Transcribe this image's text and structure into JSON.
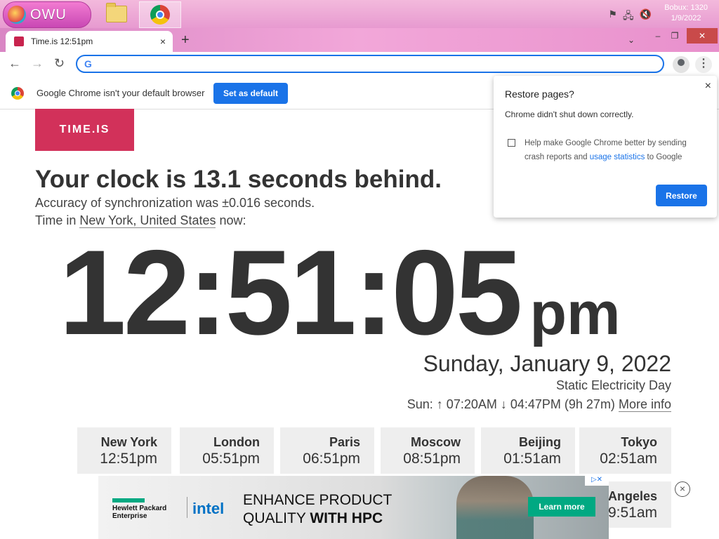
{
  "taskbar": {
    "start_label": "OWU",
    "clock_line1": "Bobux: 1320",
    "clock_line2": "1/9/2022"
  },
  "browser": {
    "tab_title": "Time.is 12:51pm",
    "new_tab": "+",
    "tab_close": "×",
    "omnibox_value": ""
  },
  "infobar": {
    "message": "Google Chrome isn't your default browser",
    "button": "Set as default"
  },
  "page": {
    "logo": "TIME.IS",
    "headline": "Your clock is 13.1 seconds behind.",
    "accuracy": "Accuracy of synchronization was ±0.016 seconds.",
    "time_in_prefix": "Time in",
    "location": "New York, United States",
    "time_in_suffix": "now:",
    "clock_time": "12:51:05",
    "clock_ampm": "pm",
    "date": "Sunday, January 9, 2022",
    "day_name": "Static Electricity Day",
    "sun_text": "Sun: ↑ 07:20AM ↓ 04:47PM (9h 27m)",
    "more_info": "More info"
  },
  "cities": [
    {
      "name": "New York",
      "time": "12:51pm"
    },
    {
      "name": "London",
      "time": "05:51pm"
    },
    {
      "name": "Paris",
      "time": "06:51pm"
    },
    {
      "name": "Moscow",
      "time": "08:51pm"
    },
    {
      "name": "Beijing",
      "time": "01:51am"
    },
    {
      "name": "Tokyo",
      "time": "02:51am"
    },
    {
      "name": "Angeles",
      "time": "9:51am"
    }
  ],
  "ad": {
    "brand1_line1": "Hewlett Packard",
    "brand1_line2": "Enterprise",
    "brand2": "intel",
    "line1": "ENHANCE PRODUCT",
    "line2_a": "QUALITY ",
    "line2_b": "WITH HPC",
    "cta": "Learn more",
    "close": "×"
  },
  "popup": {
    "title": "Restore pages?",
    "message": "Chrome didn't shut down correctly.",
    "checkbox_text_a": "Help make Google Chrome better by sending crash reports and",
    "checkbox_link": "usage statistics",
    "checkbox_text_b": "to Google",
    "button": "Restore",
    "close": "×"
  }
}
